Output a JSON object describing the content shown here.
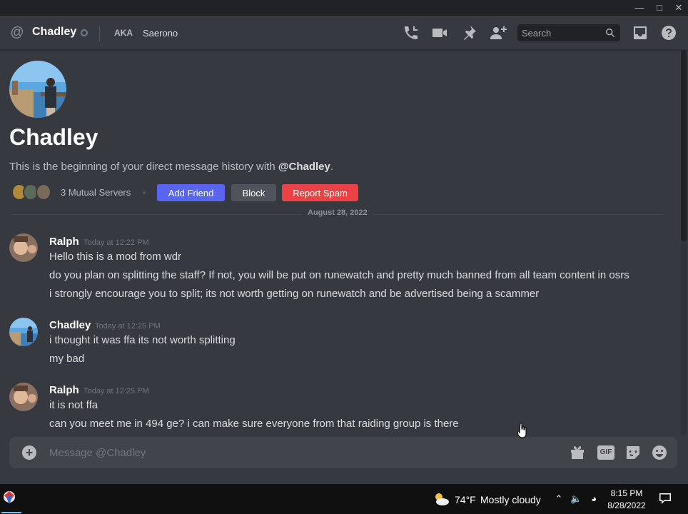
{
  "header": {
    "dm_name": "Chadley",
    "aka_label": "AKA",
    "aka_name": "Saerono",
    "search_placeholder": "Search"
  },
  "profile": {
    "name": "Chadley",
    "intro_prefix": "This is the beginning of your direct message history with ",
    "intro_handle": "@Chadley",
    "intro_suffix": ".",
    "mutual_servers": "3 Mutual Servers",
    "add_friend": "Add Friend",
    "block": "Block",
    "report_spam": "Report Spam"
  },
  "date_divider": "August 28, 2022",
  "messages": [
    {
      "author": "Ralph",
      "time": "Today at 12:22 PM",
      "lines": [
        "Hello this is a mod from wdr",
        "do you plan on splitting the staff? If not, you will be put on runewatch and pretty much banned from all team content in osrs",
        "i strongly encourage you to split; its not worth getting on runewatch and be advertised being a scammer"
      ]
    },
    {
      "author": "Chadley",
      "time": "Today at 12:25 PM",
      "lines": [
        "i thought it was ffa its not worth splitting",
        "my bad"
      ]
    },
    {
      "author": "Ralph",
      "time": "Today at 12:25 PM",
      "lines": [
        "it is not ffa",
        "can you meet me in 494 ge? i can make sure everyone from that raiding group is there"
      ]
    }
  ],
  "composer": {
    "placeholder": "Message @Chadley",
    "gif_label": "GIF"
  },
  "taskbar": {
    "temperature": "74°F",
    "weather": "Mostly cloudy",
    "time": "8:15 PM",
    "date": "8/28/2022"
  },
  "icons": {
    "header": [
      "at-icon",
      "phone-call-icon",
      "video-call-icon",
      "pin-icon",
      "add-friend-icon",
      "search-icon",
      "inbox-icon",
      "help-icon"
    ],
    "composer": [
      "add-attachment-icon",
      "gift-icon",
      "gif-icon",
      "sticker-icon",
      "emoji-icon"
    ]
  },
  "colors": {
    "background": "#36393f",
    "blurple": "#5865f2",
    "danger": "#ed4245",
    "secondary": "#4f545c"
  }
}
